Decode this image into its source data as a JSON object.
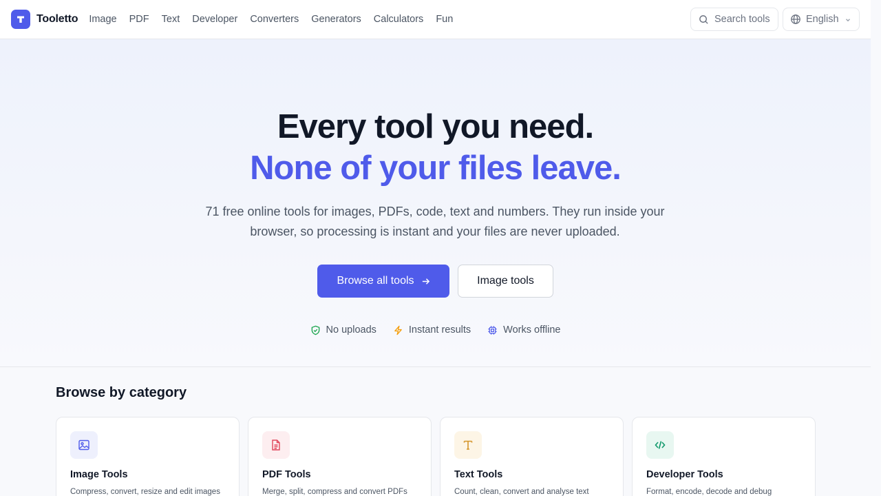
{
  "brand": {
    "name": "Tooletto",
    "logo_icon": "tool-t-icon"
  },
  "nav": [
    "Image",
    "PDF",
    "Text",
    "Developer",
    "Converters",
    "Generators",
    "Calculators",
    "Fun"
  ],
  "search": {
    "placeholder": "Search tools",
    "icon": "search-icon"
  },
  "language": {
    "selected": "English",
    "icon": "globe-icon"
  },
  "hero": {
    "title_line1": "Every tool you need.",
    "title_line2": "None of your files leave.",
    "subtitle": "71 free online tools for images, PDFs, code, text and numbers. They run inside your browser, so processing is instant and your files are never uploaded.",
    "primary_button": "Browse all tools",
    "secondary_button": "Image tools",
    "features": [
      {
        "label": "No uploads",
        "icon": "shield-check-icon"
      },
      {
        "label": "Instant results",
        "icon": "lightning-icon"
      },
      {
        "label": "Works offline",
        "icon": "chip-icon"
      }
    ]
  },
  "categories": {
    "title": "Browse by category",
    "cards": [
      {
        "title": "Image Tools",
        "desc": "Compress, convert, resize and edit images",
        "icon": "image-icon"
      },
      {
        "title": "PDF Tools",
        "desc": "Merge, split, compress and convert PDFs",
        "icon": "document-icon"
      },
      {
        "title": "Text Tools",
        "desc": "Count, clean, convert and analyse text",
        "icon": "text-t-icon"
      },
      {
        "title": "Developer Tools",
        "desc": "Format, encode, decode and debug",
        "icon": "code-icon"
      }
    ]
  },
  "colors": {
    "accent": "#4f5bea",
    "green": "#16a34a",
    "amber": "#f59e0b",
    "red": "#e0455a",
    "teal": "#10996b"
  }
}
